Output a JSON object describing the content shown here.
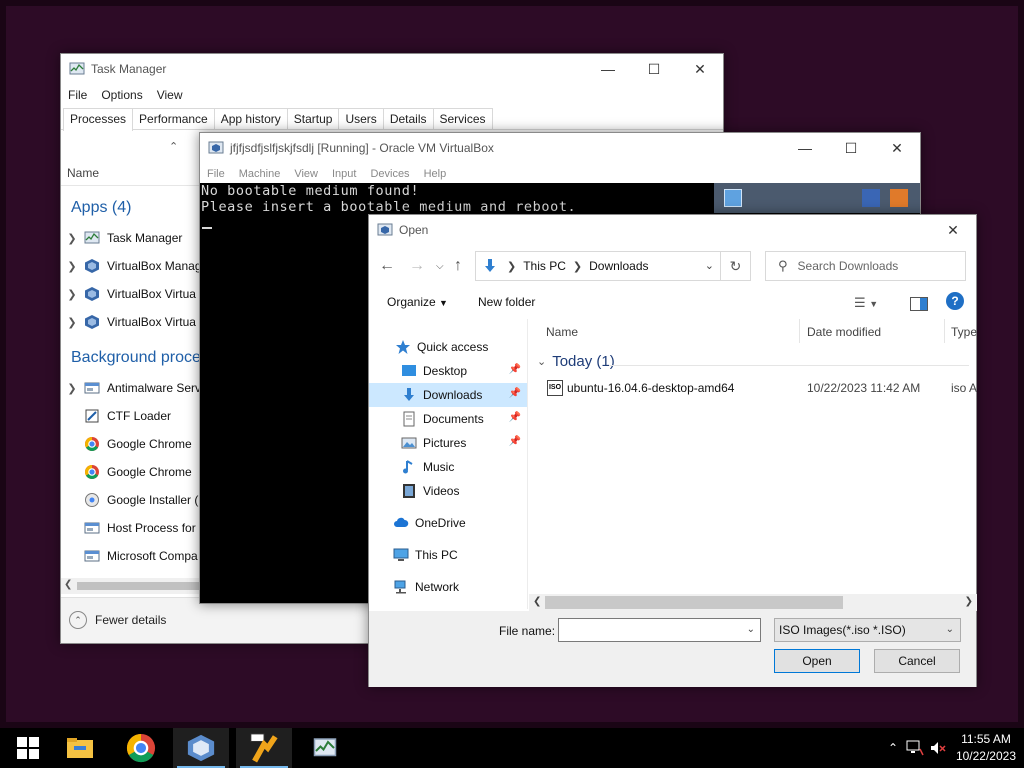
{
  "task_manager": {
    "title": "Task Manager",
    "menu": [
      "File",
      "Options",
      "View"
    ],
    "tabs": [
      "Processes",
      "Performance",
      "App history",
      "Startup",
      "Users",
      "Details",
      "Services"
    ],
    "active_tab": "Processes",
    "column_name": "Name",
    "apps_group": "Apps (4)",
    "apps": [
      {
        "label": "Task Manager",
        "icon": "task-manager-icon"
      },
      {
        "label": "VirtualBox Manag",
        "icon": "virtualbox-icon"
      },
      {
        "label": "VirtualBox Virtua",
        "icon": "virtualbox-icon"
      },
      {
        "label": "VirtualBox Virtua",
        "icon": "virtualbox-icon"
      }
    ],
    "background_group": "Background proces",
    "background": [
      {
        "label": "Antimalware Serv",
        "icon": "service-icon",
        "expandable": true
      },
      {
        "label": "CTF Loader",
        "icon": "ctf-icon",
        "expandable": false
      },
      {
        "label": "Google Chrome",
        "icon": "chrome-icon",
        "expandable": false
      },
      {
        "label": "Google Chrome",
        "icon": "chrome-icon",
        "expandable": false
      },
      {
        "label": "Google Installer (",
        "icon": "installer-icon",
        "expandable": false
      },
      {
        "label": "Host Process for",
        "icon": "service-icon",
        "expandable": false
      },
      {
        "label": "Microsoft Compa",
        "icon": "service-icon",
        "expandable": false
      }
    ],
    "fewer_details": "Fewer details"
  },
  "virtualbox": {
    "title": "jfjfjsdfjslfjskjfsdlj [Running] - Oracle VM VirtualBox",
    "menu": [
      "File",
      "Machine",
      "View",
      "Input",
      "Devices",
      "Help"
    ],
    "console_lines": [
      "No bootable medium found!",
      "Please insert a bootable medium and reboot."
    ]
  },
  "open_dialog": {
    "title": "Open",
    "breadcrumb": [
      "This PC",
      "Downloads"
    ],
    "search_placeholder": "Search Downloads",
    "organize": "Organize",
    "new_folder": "New folder",
    "sidebar": [
      {
        "label": "Quick access",
        "icon": "star-icon",
        "pinned": false,
        "selected": false
      },
      {
        "label": "Desktop",
        "icon": "desktop-icon",
        "pinned": true,
        "selected": false
      },
      {
        "label": "Downloads",
        "icon": "download-icon",
        "pinned": true,
        "selected": true
      },
      {
        "label": "Documents",
        "icon": "document-icon",
        "pinned": true,
        "selected": false
      },
      {
        "label": "Pictures",
        "icon": "pictures-icon",
        "pinned": true,
        "selected": false
      },
      {
        "label": "Music",
        "icon": "music-icon",
        "pinned": false,
        "selected": false
      },
      {
        "label": "Videos",
        "icon": "videos-icon",
        "pinned": false,
        "selected": false
      },
      {
        "label": "OneDrive",
        "icon": "cloud-icon",
        "pinned": false,
        "selected": false
      },
      {
        "label": "This PC",
        "icon": "computer-icon",
        "pinned": false,
        "selected": false
      },
      {
        "label": "Network",
        "icon": "network-icon",
        "pinned": false,
        "selected": false
      }
    ],
    "columns": {
      "name": "Name",
      "date": "Date modified",
      "type": "Type"
    },
    "group": "Today (1)",
    "files": [
      {
        "name": "ubuntu-16.04.6-desktop-amd64",
        "date": "10/22/2023 11:42 AM",
        "type": "iso A"
      }
    ],
    "file_name_label": "File name:",
    "file_name_value": "",
    "file_type": "ISO Images(*.iso *.ISO)",
    "open_button": "Open",
    "cancel_button": "Cancel"
  },
  "taskbar": {
    "items": [
      "start-icon",
      "file-explorer-icon",
      "chrome-icon",
      "virtualbox-icon",
      "virtualbox-64-icon",
      "task-manager-icon"
    ],
    "time": "11:55 AM",
    "date": "10/22/2023"
  },
  "colors": {
    "desktop": "#2d0b26",
    "accent": "#0078d7",
    "selection": "#cce8ff",
    "group_blue": "#1f5fa8"
  }
}
